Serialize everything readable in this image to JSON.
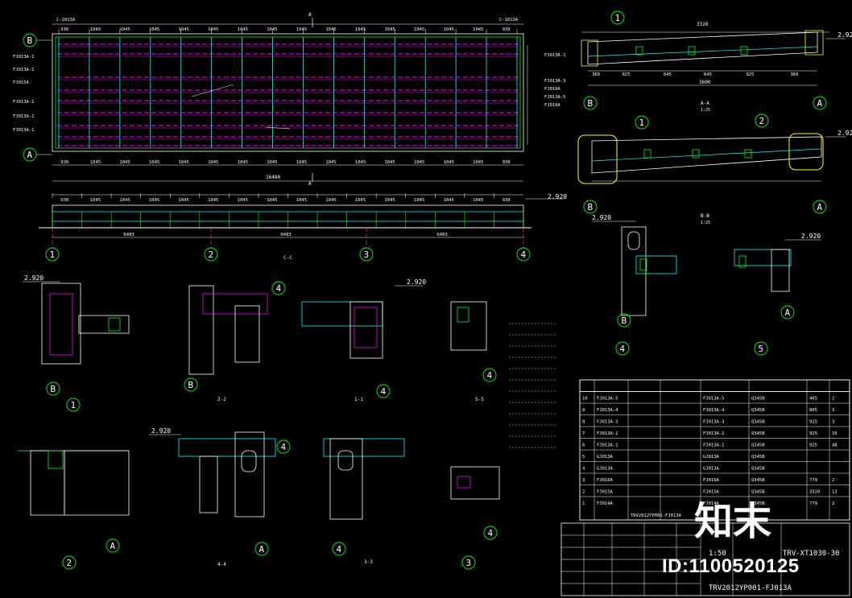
{
  "drawing": {
    "grid_top": [
      "B",
      "A"
    ],
    "grid_left": [
      "B",
      "A"
    ],
    "grid_bottom": [
      "1",
      "2",
      "3",
      "4"
    ],
    "section_marks": [
      "A",
      "A"
    ],
    "plan_top_labels": [
      "C-1013A",
      "C-1013A"
    ],
    "plan_row_labels": [
      "FJ013A-1",
      "FJ013A-2",
      "FJ015A",
      "FJ013A-2",
      "FJ013A-1",
      "FJ013A-1"
    ],
    "plan_right_labels": [
      "FJ013A-1",
      "FJ013A-3",
      "FJ016A",
      "FJ013A-5",
      "FJ016A"
    ],
    "plan_dims": [
      "930",
      "1045",
      "1045",
      "1045",
      "1045",
      "1045",
      "1045",
      "1045",
      "1045",
      "1045",
      "1045",
      "1045",
      "1045",
      "1045",
      "1045",
      "930"
    ],
    "plan_total": "16480",
    "elev_dims": [
      "930",
      "1045",
      "1045",
      "1045",
      "1045",
      "1045",
      "1045",
      "1045",
      "1045",
      "1045",
      "1045",
      "1045",
      "1045",
      "1045",
      "1045",
      "930"
    ],
    "elev_spans": [
      "6483",
      "6483",
      "6483"
    ],
    "elev_level": "2.920",
    "elev_title": "C-C",
    "section_aa_title": "A-A",
    "section_aa_scale": "1:25",
    "section_aa_total": "3320",
    "section_aa_bottom": [
      "360",
      "925",
      "645",
      "645",
      "925",
      "360"
    ],
    "section_aa_overall": "3600",
    "section_bb_title": "B-B",
    "section_bb_scale": "1:25",
    "level_marks": [
      "2.920",
      "2.920",
      "2.920",
      "2.920",
      "2.920",
      "2.920",
      "2.920"
    ],
    "details": [
      {
        "num": "1",
        "scale": "1:10"
      },
      {
        "num": "2",
        "scale": "1:10"
      },
      {
        "num": "3",
        "scale": "1:10"
      },
      {
        "num": "4",
        "scale": "1:10"
      },
      {
        "num": "5",
        "scale": "1:10"
      }
    ],
    "cuts": [
      "2-2",
      "1-1",
      "5-5",
      "4-4",
      "3-3"
    ]
  },
  "table": {
    "rows": [
      [
        "10",
        "FJ013A-5",
        "",
        "",
        "FJ013A-5",
        "Q345B",
        "405",
        "2"
      ],
      [
        "9",
        "FJ013A-4",
        "",
        "",
        "FJ013A-4",
        "Q345B",
        "805",
        "3"
      ],
      [
        "8",
        "FJ013A-3",
        "",
        "",
        "FJ013A-3",
        "Q345B",
        "925",
        "3"
      ],
      [
        "7",
        "FJ013A-2",
        "",
        "",
        "FJ013A-2",
        "Q345B",
        "925",
        "16"
      ],
      [
        "6",
        "FJ013A-1",
        "",
        "",
        "FJ013A-1",
        "Q345B",
        "925",
        "48"
      ],
      [
        "5",
        "GJ013A",
        "",
        "",
        "GJ013A",
        "Q345B",
        "",
        ""
      ],
      [
        "4",
        "GJ013A",
        "",
        "",
        "GJ013A",
        "Q345B",
        "",
        ""
      ],
      [
        "3",
        "FJ016A",
        "",
        "",
        "FJ016A",
        "Q345B",
        "779",
        "2"
      ],
      [
        "2",
        "FJ015A",
        "",
        "",
        "FJ015A",
        "Q345B",
        "3320",
        "13"
      ],
      [
        "1",
        "FJ014A",
        "",
        "",
        "FJ014A",
        "Q345B",
        "779",
        "2"
      ]
    ],
    "footer_ref": "TRV2012YP001-FJ013A"
  },
  "title_block": {
    "scale": "1:50",
    "drawing_no": "TRV-XT1030-30",
    "ref": "TRV2012YP001-FJ013A"
  },
  "watermark": {
    "logo": "知末",
    "id": "ID:1100520125"
  },
  "colors": {
    "background": "#000000",
    "magenta": "#ff00ff",
    "cyan": "#00ffff",
    "green": "#00ff00",
    "yellow": "#ffff00",
    "red": "#ff3030",
    "white": "#ffffff"
  }
}
